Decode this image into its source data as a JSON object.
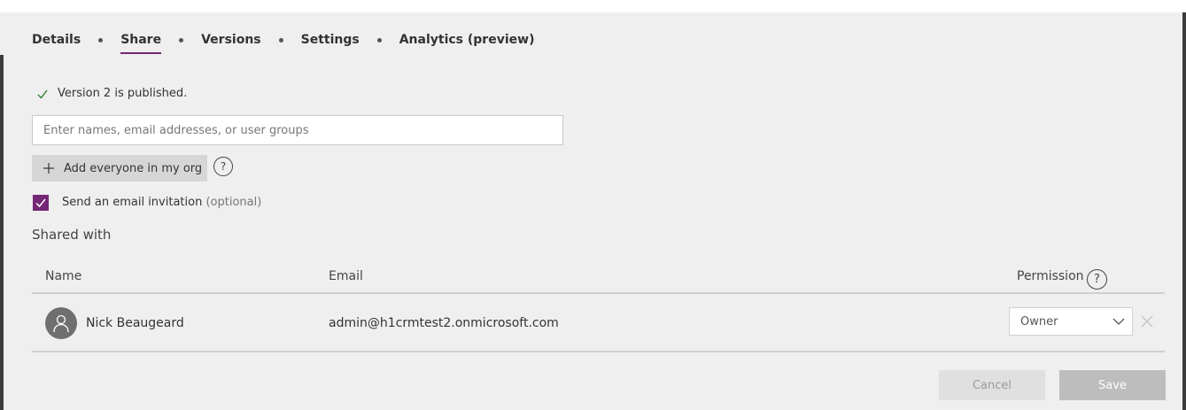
{
  "tabs": [
    {
      "label": "Details"
    },
    {
      "label": "Share"
    },
    {
      "label": "Versions"
    },
    {
      "label": "Settings"
    },
    {
      "label": "Analytics (preview)"
    }
  ],
  "active_tab": "Share",
  "status": {
    "text": "Version 2 is published.",
    "icon": "checkmark-icon"
  },
  "share_input": {
    "placeholder": "Enter names, email addresses, or user groups",
    "value": ""
  },
  "add_everyone": {
    "label": "Add everyone in my org",
    "icon": "plus-icon"
  },
  "help_glyph": "?",
  "email_invitation": {
    "label": "Send an email invitation",
    "optional": "(optional)",
    "checked": true
  },
  "shared_with": {
    "heading": "Shared with",
    "columns": {
      "name": "Name",
      "email": "Email",
      "permission": "Permission"
    },
    "rows": [
      {
        "name": "Nick Beaugeard",
        "email": "admin@h1crmtest2.onmicrosoft.com",
        "permission": "Owner"
      }
    ]
  },
  "actions": {
    "cancel": "Cancel",
    "save": "Save"
  },
  "colors": {
    "accent": "#742774",
    "background": "#efefef"
  }
}
